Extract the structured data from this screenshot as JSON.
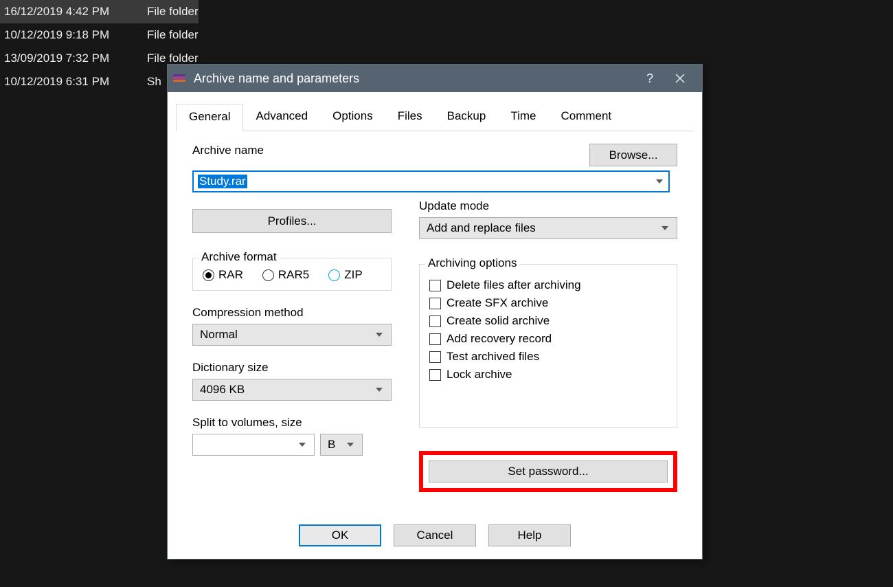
{
  "background": {
    "rows": [
      {
        "date": "16/12/2019 4:42 PM",
        "type": "File folder",
        "selected": true
      },
      {
        "date": "10/12/2019 9:18 PM",
        "type": "File folder",
        "selected": false
      },
      {
        "date": "13/09/2019 7:32 PM",
        "type": "File folder",
        "selected": false
      },
      {
        "date": "10/12/2019 6:31 PM",
        "type": "Sh",
        "selected": false
      }
    ]
  },
  "dialog": {
    "title": "Archive name and parameters",
    "tabs": [
      "General",
      "Advanced",
      "Options",
      "Files",
      "Backup",
      "Time",
      "Comment"
    ],
    "active_tab": 0,
    "labels": {
      "archive_name": "Archive name",
      "browse": "Browse...",
      "profiles": "Profiles...",
      "update_mode": "Update mode",
      "archive_format": "Archive format",
      "archiving_options": "Archiving options",
      "compression_method": "Compression method",
      "dictionary_size": "Dictionary size",
      "split": "Split to volumes, size",
      "set_password": "Set password..."
    },
    "archive_name_value": "Study.rar",
    "update_mode_value": "Add and replace files",
    "format_options": [
      "RAR",
      "RAR5",
      "ZIP"
    ],
    "format_selected": "RAR",
    "compression_value": "Normal",
    "dictionary_value": "4096 KB",
    "split_unit": "B",
    "archiving_checkboxes": [
      "Delete files after archiving",
      "Create SFX archive",
      "Create solid archive",
      "Add recovery record",
      "Test archived files",
      "Lock archive"
    ],
    "buttons": {
      "ok": "OK",
      "cancel": "Cancel",
      "help": "Help"
    }
  }
}
